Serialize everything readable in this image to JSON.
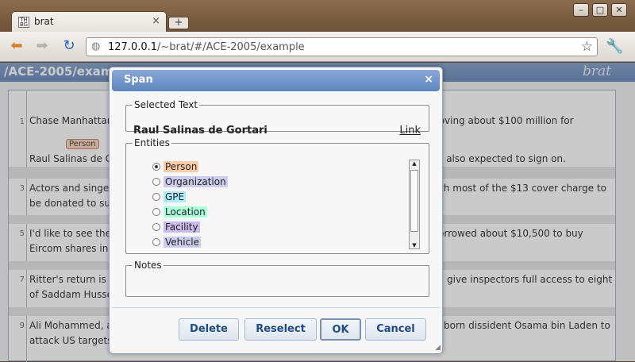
{
  "browser": {
    "tab_title": "brat",
    "tab_close": "×",
    "new_tab": "+",
    "url_host": "127.0.0.1",
    "url_path": "/~brat/#/ACE-2005/example",
    "window_buttons": [
      "–",
      "□",
      "✕"
    ]
  },
  "brat": {
    "doc_title": "/ACE-2005/examp",
    "logo": "brat",
    "rows": [
      {
        "num": "1",
        "text": "Chase Manhattan",
        "right": "moving about $100 million for"
      },
      {
        "num": "",
        "text": "Raul Salinas de G",
        "right": "e also expected to sign on."
      },
      {
        "num": "3",
        "text": "Actors and singer",
        "right": "with most of the $13 cover charge to"
      },
      {
        "num": "",
        "text": "be donated to sup",
        "right": ""
      },
      {
        "num": "5",
        "text": "I'd like to see the",
        "right": "orrowed about $10,500 to buy"
      },
      {
        "num": "",
        "text": "Eircom shares in",
        "right": ""
      },
      {
        "num": "7",
        "text": "Ritter's return is s",
        "right": "give inspectors full access to eight"
      },
      {
        "num": "",
        "text": "of Saddam Husse",
        "right": ""
      },
      {
        "num": "9",
        "text": "Ali Mohammed, a",
        "right": "born dissident Osama bin Laden to"
      },
      {
        "num": "",
        "text": "attack US targets",
        "right": ""
      }
    ],
    "span_label": "Person"
  },
  "dialog": {
    "title": "Span",
    "close": "×",
    "selected_legend": "Selected Text",
    "selected_text": "Raul Salinas de Gortari",
    "link": "Link",
    "entities_legend": "Entities",
    "entities": [
      {
        "label": "Person",
        "color": "#ffccaa",
        "checked": true
      },
      {
        "label": "Organization",
        "color": "#ccccee",
        "checked": false
      },
      {
        "label": "GPE",
        "color": "#aaeeff",
        "checked": false
      },
      {
        "label": "Location",
        "color": "#aaffdd",
        "checked": false
      },
      {
        "label": "Facility",
        "color": "#ccbbee",
        "checked": false
      },
      {
        "label": "Vehicle",
        "color": "#ccccee",
        "checked": false
      }
    ],
    "notes_legend": "Notes",
    "buttons": {
      "delete": "Delete",
      "reselect": "Reselect",
      "ok": "OK",
      "cancel": "Cancel"
    }
  }
}
